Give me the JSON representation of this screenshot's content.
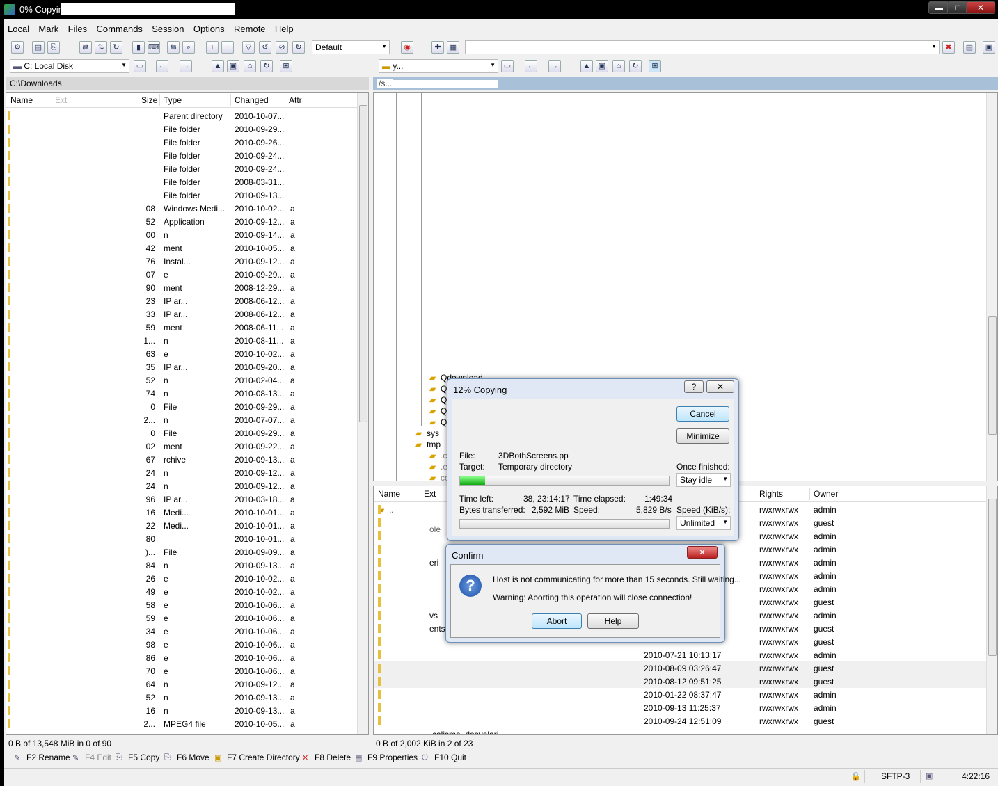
{
  "window": {
    "title": "0% Copying - ",
    "min": "▬",
    "max": "□",
    "close": "✕"
  },
  "menu": [
    "Local",
    "Mark",
    "Files",
    "Commands",
    "Session",
    "Options",
    "Remote",
    "Help"
  ],
  "toolbar": {
    "profile": "Default"
  },
  "local": {
    "drive": "C: Local Disk",
    "path": "C:\\Downloads",
    "columns": {
      "name": "Name",
      "ext": "Ext",
      "size": "Size",
      "type": "Type",
      "changed": "Changed",
      "attr": "Attr"
    },
    "rows": [
      {
        "size": "",
        "type": "Parent directory",
        "changed": "2010-10-07...",
        "attr": ""
      },
      {
        "size": "",
        "type": "File folder",
        "changed": "2010-09-29...",
        "attr": ""
      },
      {
        "size": "",
        "type": "File folder",
        "changed": "2010-09-26...",
        "attr": ""
      },
      {
        "size": "",
        "type": "File folder",
        "changed": "2010-09-24...",
        "attr": ""
      },
      {
        "size": "",
        "type": "File folder",
        "changed": "2010-09-24...",
        "attr": ""
      },
      {
        "size": "",
        "type": "File folder",
        "changed": "2008-03-31...",
        "attr": ""
      },
      {
        "size": "",
        "type": "File folder",
        "changed": "2010-09-13...",
        "attr": ""
      },
      {
        "size": "08",
        "type": "Windows Medi...",
        "changed": "2010-10-02...",
        "attr": "a"
      },
      {
        "size": "52",
        "type": "Application",
        "changed": "2010-09-12...",
        "attr": "a"
      },
      {
        "size": "00",
        "type": "n",
        "changed": "2010-09-14...",
        "attr": "a"
      },
      {
        "size": "42",
        "type": "ment",
        "changed": "2010-10-05...",
        "attr": "a"
      },
      {
        "size": "76",
        "type": "Instal...",
        "changed": "2010-09-12...",
        "attr": "a"
      },
      {
        "size": "07",
        "type": "e",
        "changed": "2010-09-29...",
        "attr": "a"
      },
      {
        "size": "90",
        "type": "ment",
        "changed": "2008-12-29...",
        "attr": "a"
      },
      {
        "size": "23",
        "type": "IP ar...",
        "changed": "2008-06-12...",
        "attr": "a"
      },
      {
        "size": "33",
        "type": "IP ar...",
        "changed": "2008-06-12...",
        "attr": "a"
      },
      {
        "size": "59",
        "type": "ment",
        "changed": "2008-06-11...",
        "attr": "a"
      },
      {
        "size": "1...",
        "type": "n",
        "changed": "2010-08-11...",
        "attr": "a"
      },
      {
        "size": "63",
        "type": "e",
        "changed": "2010-10-02...",
        "attr": "a"
      },
      {
        "size": "35",
        "type": "IP ar...",
        "changed": "2010-09-20...",
        "attr": "a"
      },
      {
        "size": "52",
        "type": "n",
        "changed": "2010-02-04...",
        "attr": "a"
      },
      {
        "size": "74",
        "type": "n",
        "changed": "2010-08-13...",
        "attr": "a"
      },
      {
        "size": "0",
        "type": "File",
        "changed": "2010-09-29...",
        "attr": "a"
      },
      {
        "size": "2...",
        "type": "n",
        "changed": "2010-07-07...",
        "attr": "a"
      },
      {
        "size": "0",
        "type": "File",
        "changed": "2010-09-29...",
        "attr": "a"
      },
      {
        "size": "02",
        "type": "ment",
        "changed": "2010-09-22...",
        "attr": "a"
      },
      {
        "size": "67",
        "type": "rchive",
        "changed": "2010-09-13...",
        "attr": "a"
      },
      {
        "size": "24",
        "type": "n",
        "changed": "2010-09-12...",
        "attr": "a"
      },
      {
        "size": "24",
        "type": "n",
        "changed": "2010-09-12...",
        "attr": "a"
      },
      {
        "size": "96",
        "type": "IP ar...",
        "changed": "2010-03-18...",
        "attr": "a"
      },
      {
        "size": "16",
        "type": "Medi...",
        "changed": "2010-10-01...",
        "attr": "a"
      },
      {
        "size": "22",
        "type": "Medi...",
        "changed": "2010-10-01...",
        "attr": "a"
      },
      {
        "size": "80",
        "type": "",
        "changed": "2010-10-01...",
        "attr": "a"
      },
      {
        "size": ")...",
        "type": "File",
        "changed": "2010-09-09...",
        "attr": "a"
      },
      {
        "size": "84",
        "type": "n",
        "changed": "2010-09-13...",
        "attr": "a"
      },
      {
        "size": "26",
        "type": "e",
        "changed": "2010-10-02...",
        "attr": "a"
      },
      {
        "size": "49",
        "type": "e",
        "changed": "2010-10-02...",
        "attr": "a"
      },
      {
        "size": "58",
        "type": "e",
        "changed": "2010-10-06...",
        "attr": "a"
      },
      {
        "size": "59",
        "type": "e",
        "changed": "2010-10-06...",
        "attr": "a"
      },
      {
        "size": "34",
        "type": "e",
        "changed": "2010-10-06...",
        "attr": "a"
      },
      {
        "size": "98",
        "type": "e",
        "changed": "2010-10-06...",
        "attr": "a"
      },
      {
        "size": "86",
        "type": "e",
        "changed": "2010-10-06...",
        "attr": "a"
      },
      {
        "size": "70",
        "type": "e",
        "changed": "2010-10-06...",
        "attr": "a"
      },
      {
        "size": "64",
        "type": "n",
        "changed": "2010-09-12...",
        "attr": "a"
      },
      {
        "size": "52",
        "type": "n",
        "changed": "2010-09-13...",
        "attr": "a"
      },
      {
        "size": "16",
        "type": "n",
        "changed": "2010-09-13...",
        "attr": "a"
      },
      {
        "size": "2...",
        "type": "MPEG4 file",
        "changed": "2010-10-05...",
        "attr": "a"
      }
    ],
    "status": "0 B of 13,548 MiB in 0 of 90"
  },
  "remote": {
    "dir": "y...",
    "path": "/s...",
    "tree": [
      "Qdownload",
      "Qmul",
      "Qreco",
      "Qusb",
      "Qweb",
      "sys",
      "tmp",
      ".custo",
      ".eacce",
      "config"
    ],
    "columns": {
      "name": "Name",
      "ext": "Ext",
      "rights": "Rights",
      "owner": "Owner"
    },
    "parent": "..",
    "partial_names": [
      "ole",
      "eri",
      "vs",
      "ents"
    ],
    "rows": [
      {
        "changed": "",
        "rights": "rwxrwxrwx",
        "owner": "admin"
      },
      {
        "changed": "",
        "rights": "rwxrwxrwx",
        "owner": "guest"
      },
      {
        "changed": "",
        "rights": "rwxrwxrwx",
        "owner": "admin"
      },
      {
        "changed": "",
        "rights": "rwxrwxrwx",
        "owner": "admin"
      },
      {
        "changed": "",
        "rights": "rwxrwxrwx",
        "owner": "admin"
      },
      {
        "changed": "",
        "rights": "rwxrwxrwx",
        "owner": "admin"
      },
      {
        "changed": "",
        "rights": "rwxrwxrwx",
        "owner": "admin"
      },
      {
        "changed": "",
        "rights": "rwxrwxrwx",
        "owner": "guest"
      },
      {
        "changed": "",
        "rights": "rwxrwxrwx",
        "owner": "admin"
      },
      {
        "changed": "",
        "rights": "rwxrwxrwx",
        "owner": "guest"
      },
      {
        "changed": "",
        "rights": "rwxrwxrwx",
        "owner": "guest"
      },
      {
        "changed": "2010-07-21 10:13:17",
        "rights": "rwxrwxrwx",
        "owner": "admin"
      },
      {
        "changed": "2010-08-09 03:26:47",
        "rights": "rwxrwxrwx",
        "owner": "guest"
      },
      {
        "changed": "2010-08-12 09:51:25",
        "rights": "rwxrwxrwx",
        "owner": "guest"
      },
      {
        "changed": "2010-01-22 08:37:47",
        "rights": "rwxrwxrwx",
        "owner": "admin"
      },
      {
        "changed": "2010-09-13 11:25:37",
        "rights": "rwxrwxrwx",
        "owner": "admin"
      },
      {
        "changed": "2010-09-24 12:51:09",
        "rights": "rwxrwxrwx",
        "owner": "guest"
      }
    ],
    "last_name": "calisma_dosyalari",
    "status": "0 B of 2,002 KiB in 2 of 23"
  },
  "fkeys": [
    {
      "label": "F2 Rename",
      "icon": "✎"
    },
    {
      "label": "F4 Edit",
      "icon": "✎"
    },
    {
      "label": "F5 Copy",
      "icon": "⎘"
    },
    {
      "label": "F6 Move",
      "icon": "⎘"
    },
    {
      "label": "F7 Create Directory",
      "icon": "▣"
    },
    {
      "label": "F8 Delete",
      "icon": "✕"
    },
    {
      "label": "F9 Properties",
      "icon": "▤"
    },
    {
      "label": "F10 Quit",
      "icon": "⏻"
    }
  ],
  "statusbar": {
    "protocol": "SFTP-3",
    "time": "4:22:16"
  },
  "copy_dialog": {
    "title": "12% Copying",
    "help": "?",
    "close": "✕",
    "cancel": "Cancel",
    "minimize": "Minimize",
    "file_label": "File:",
    "file": "3DBothScreens.pp",
    "target_label": "Target:",
    "target": "Temporary directory",
    "once_finished": "Once finished:",
    "once_value": "Stay idle",
    "progress": 0.12,
    "time_left_label": "Time left:",
    "time_left": "38, 23:14:17",
    "elapsed_label": "Time elapsed:",
    "elapsed": "1:49:34",
    "bytes_label": "Bytes transferred:",
    "bytes": "2,592 MiB",
    "speed_label": "Speed:",
    "speed": "5,829 B/s",
    "speed_limit_label": "Speed (KiB/s):",
    "speed_limit": "Unlimited"
  },
  "confirm_dialog": {
    "title": "Confirm",
    "close": "✕",
    "message": "Host is not communicating for more than 15 seconds. Still waiting...",
    "warning": "Warning: Aborting this operation will close connection!",
    "abort": "Abort",
    "help": "Help"
  }
}
